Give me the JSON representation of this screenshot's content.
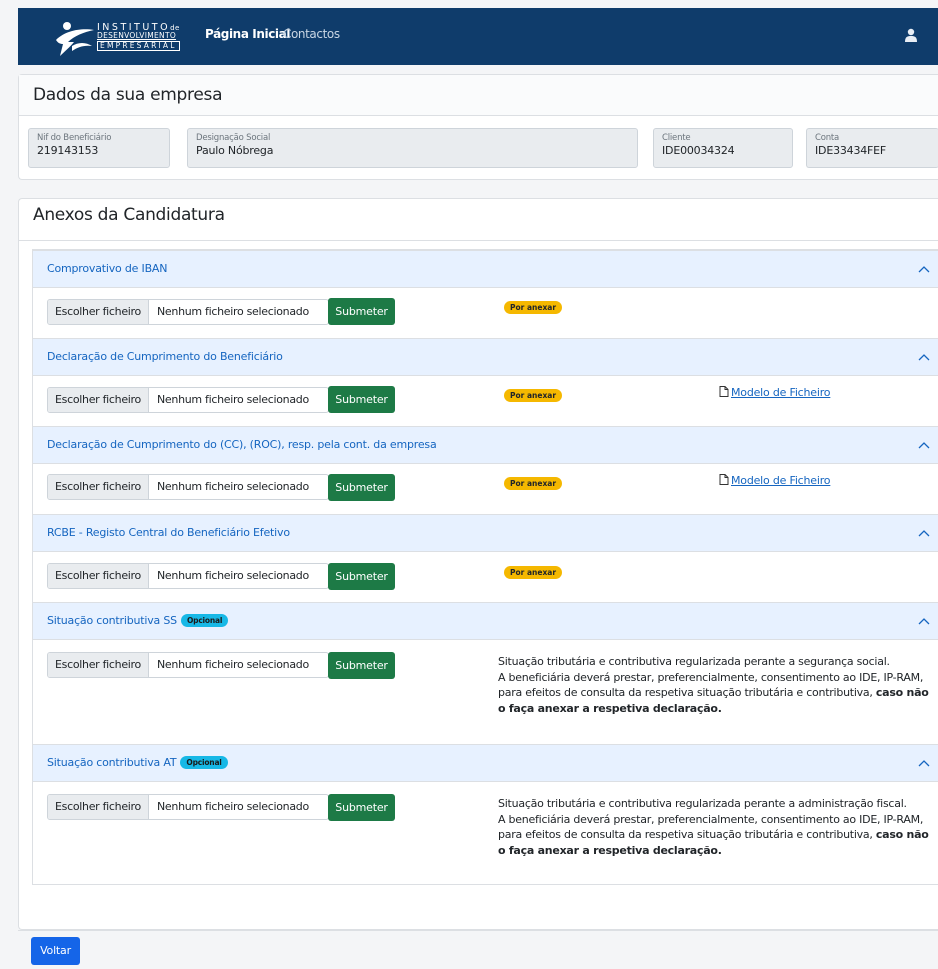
{
  "header": {
    "logo_line1": "INSTITUTO",
    "logo_line1_suffix": "de",
    "logo_line2": "DESENVOLVIMENTO",
    "logo_line3": "EMPRESARIAL",
    "nav_home": "Página Inicial",
    "nav_contacts": "Contactos",
    "user_icon": "user-icon"
  },
  "company": {
    "title": "Dados da sua empresa",
    "fields": [
      {
        "label": "Nif do Beneficiário",
        "value": "219143153"
      },
      {
        "label": "Designação Social",
        "value": "Paulo Nóbrega"
      },
      {
        "label": "Cliente",
        "value": "IDE00034324"
      },
      {
        "label": "Conta",
        "value": "IDE33434FEF"
      }
    ]
  },
  "annex": {
    "title": "Anexos da Candidatura",
    "file_button": "Escolher ficheiro",
    "no_file": "Nenhum ficheiro selecionado",
    "submit": "Submeter",
    "pending_badge": "Por anexar",
    "optional_badge": "Opcional",
    "model_link": "Modelo de Ficheiro",
    "items": [
      {
        "title": "Comprovativo de IBAN"
      },
      {
        "title": "Declaração de Cumprimento do Beneficiário"
      },
      {
        "title": "Declaração de Cumprimento do (CC), (ROC), resp. pela cont. da empresa"
      },
      {
        "title": "RCBE - Registo Central do Beneficiário Efetivo"
      },
      {
        "title": "Situação contributiva SS",
        "note_line1": "Situação tributária e contributiva regularizada perante a segurança social.",
        "note_line2": "A beneficiária deverá prestar, preferencialmente, consentimento ao IDE, IP-RAM, para efeitos de consulta da respetiva situação tributária e contributiva, ",
        "note_bold": "caso não o faça anexar a respetiva declaração."
      },
      {
        "title": "Situação contributiva AT",
        "note_line1": "Situação tributária e contributiva regularizada perante a administração fiscal.",
        "note_line2": "A beneficiária deverá prestar, preferencialmente, consentimento ao IDE, IP-RAM, para efeitos de consulta da respetiva situação tributária e contributiva, ",
        "note_bold": "caso não o faça anexar a respetiva declaração."
      }
    ]
  },
  "footer": {
    "back_button": "Voltar"
  }
}
